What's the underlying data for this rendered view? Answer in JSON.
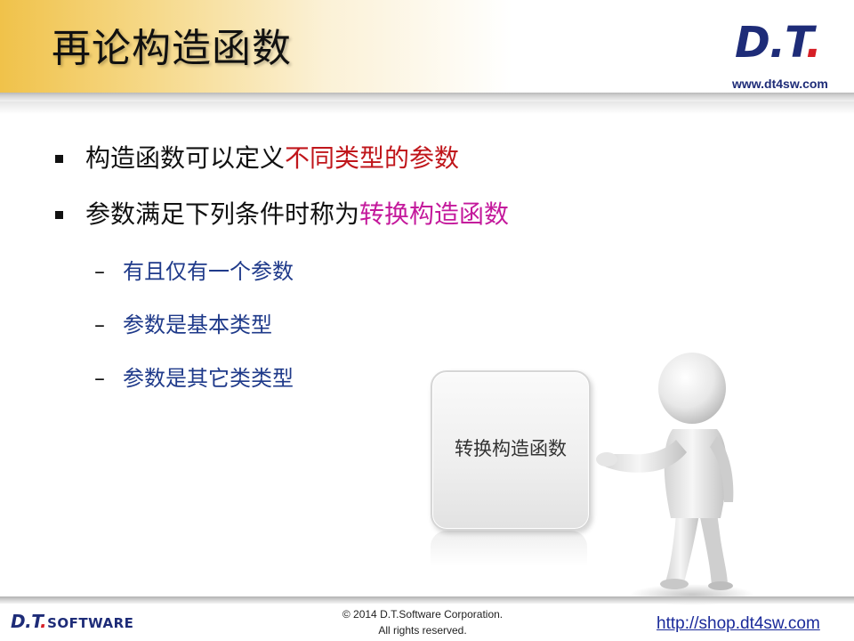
{
  "header": {
    "title": "再论构造函数",
    "logo_main": "D.T",
    "logo_dot": ".",
    "logo_url": "www.dt4sw.com"
  },
  "bullets": [
    {
      "prefix": "构造函数可以定义",
      "highlight": "不同类型的参数",
      "highlight_color": "#c0161b"
    },
    {
      "prefix": "参数满足下列条件时称为",
      "highlight": "转换构造函数",
      "highlight_color": "#c41a9c"
    }
  ],
  "sub_items": [
    {
      "dash": "–",
      "text": "有且仅有一个参数"
    },
    {
      "dash": "–",
      "text": "参数是基本类型"
    },
    {
      "dash": "–",
      "text": "参数是其它类类型"
    }
  ],
  "callout": {
    "label": "转换构造函数"
  },
  "footer": {
    "logo_main": "D.T",
    "logo_dot": ".",
    "logo_suffix": "SOFTWARE",
    "copyright_line1": "© 2014 D.T.Software Corporation.",
    "copyright_line2": "All rights reserved.",
    "shop_url": "http://shop.dt4sw.com"
  },
  "colors": {
    "title_band": "#f0c24a",
    "logo_blue": "#1e2c78",
    "logo_red": "#d61f26",
    "sub_item_blue": "#1f3a8a"
  }
}
